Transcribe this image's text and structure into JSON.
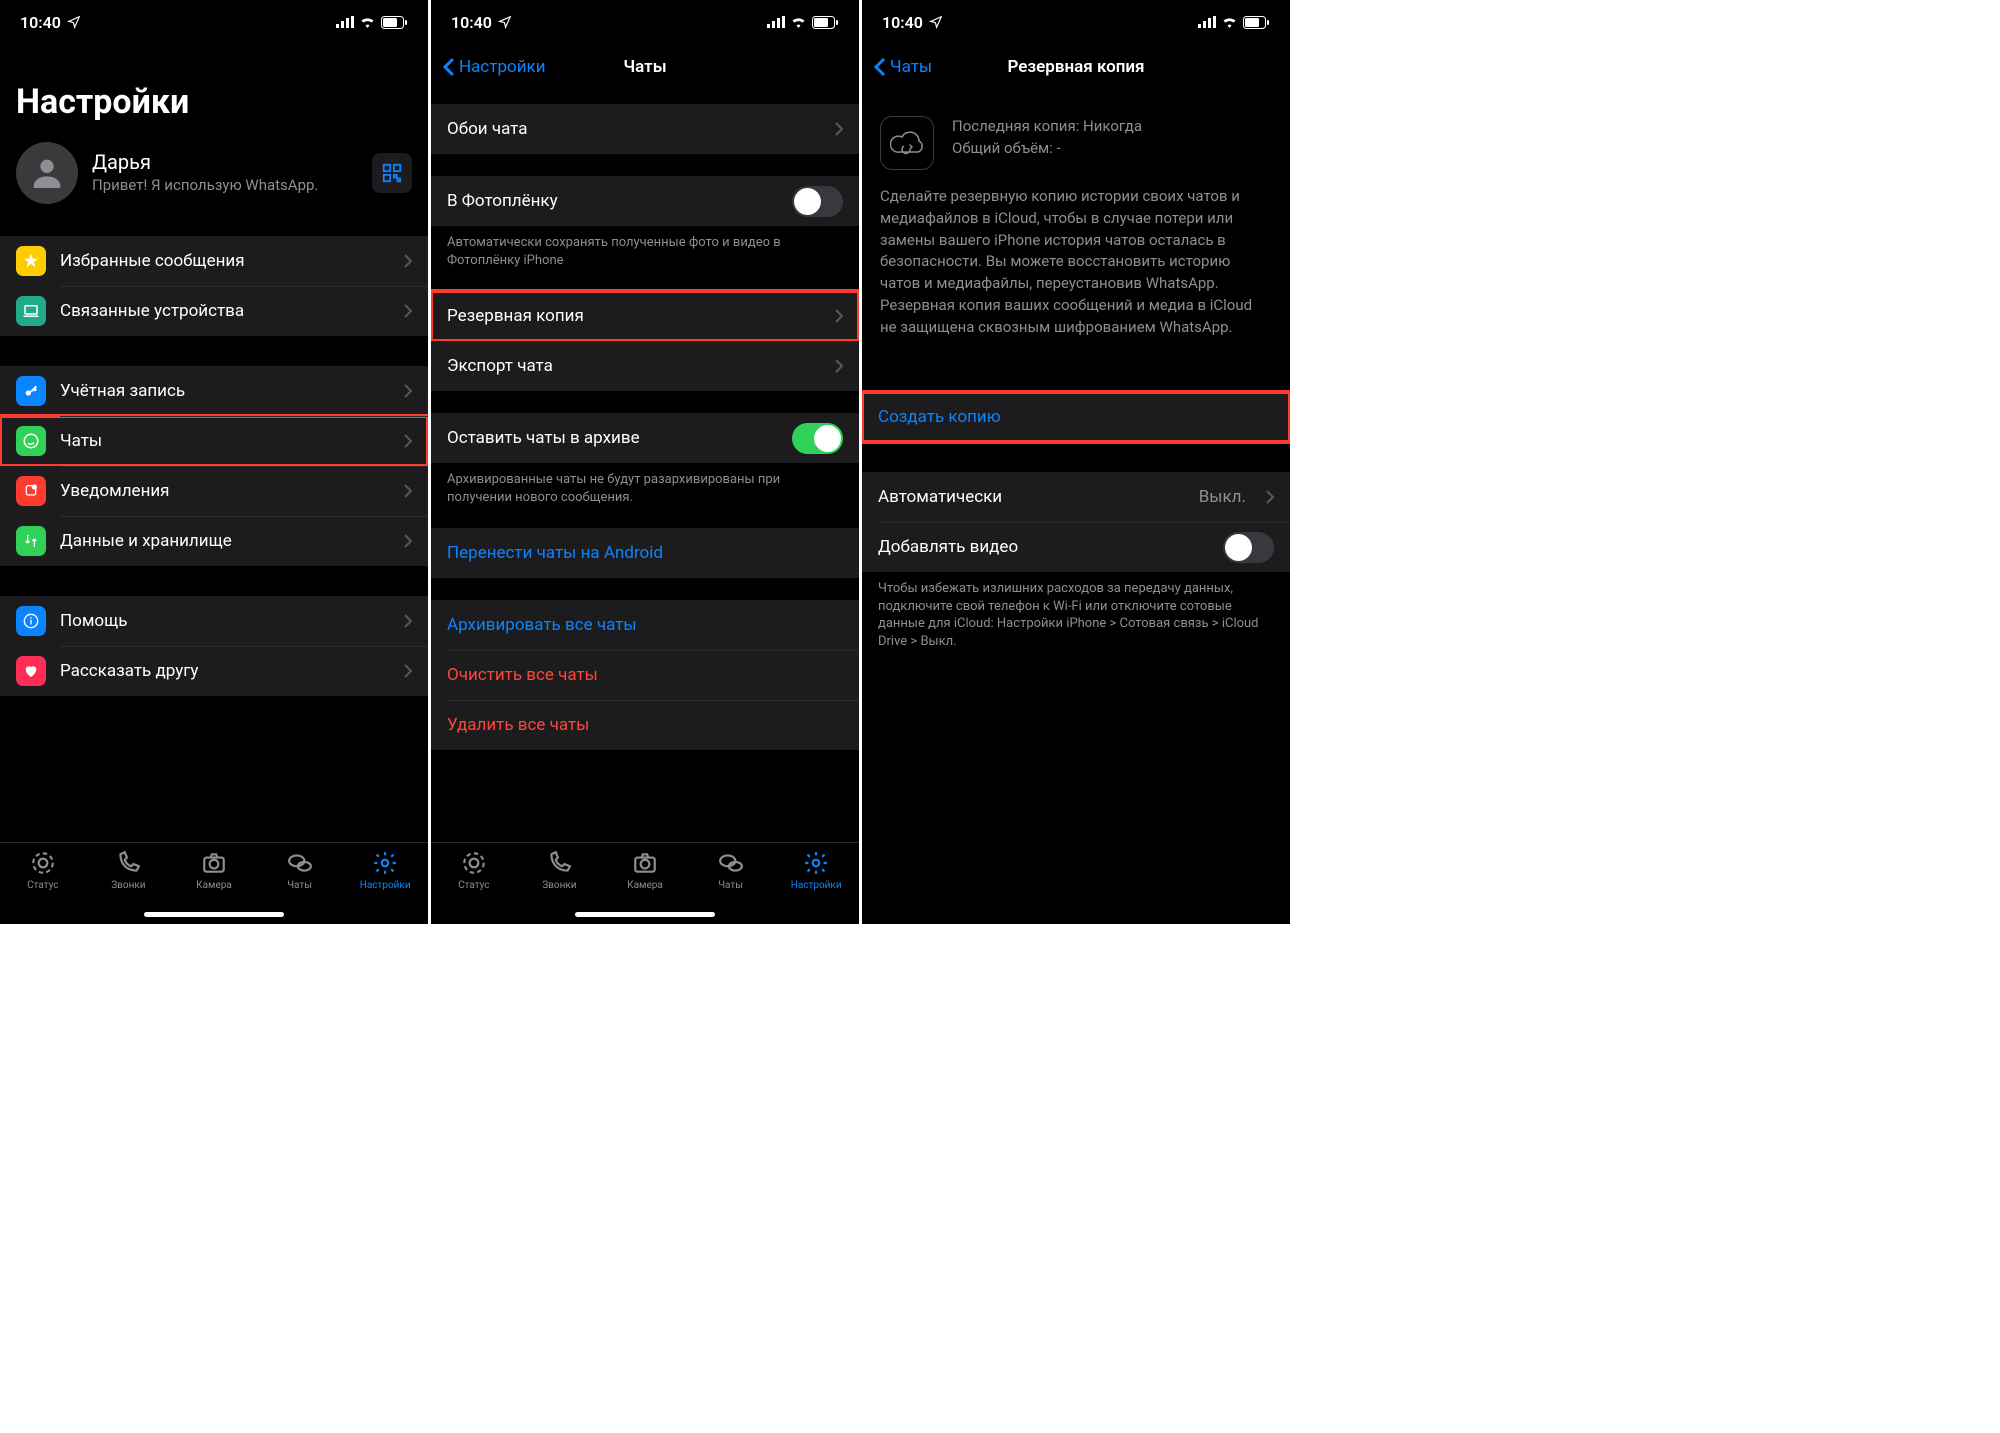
{
  "status": {
    "time": "10:40"
  },
  "tabs": {
    "status": "Статус",
    "calls": "Звонки",
    "camera": "Камера",
    "chats": "Чаты",
    "settings": "Настройки"
  },
  "screen1": {
    "title": "Настройки",
    "profile": {
      "name": "Дарья",
      "status": "Привет! Я использую WhatsApp."
    },
    "rows": {
      "starred": "Избранные сообщения",
      "linked": "Связанные устройства",
      "account": "Учётная запись",
      "chats": "Чаты",
      "notifications": "Уведомления",
      "storage": "Данные и хранилище",
      "help": "Помощь",
      "tell": "Рассказать другу"
    }
  },
  "screen2": {
    "back": "Настройки",
    "title": "Чаты",
    "rows": {
      "wallpaper": "Обои чата",
      "saveMedia": "В Фотоплёнку",
      "saveMediaNote": "Автоматически сохранять полученные фото и видео в Фотоплёнку iPhone",
      "backup": "Резервная копия",
      "export": "Экспорт чата",
      "keepArchived": "Оставить чаты в архиве",
      "keepArchivedNote": "Архивированные чаты не будут разархивированы при получении нового сообщения.",
      "moveAndroid": "Перенести чаты на Android",
      "archiveAll": "Архивировать все чаты",
      "clearAll": "Очистить все чаты",
      "deleteAll": "Удалить все чаты"
    }
  },
  "screen3": {
    "back": "Чаты",
    "title": "Резервная копия",
    "lastBackup": "Последняя копия: Никогда",
    "totalSize": "Общий объём: -",
    "description": "Сделайте резервную копию истории своих чатов и медиафайлов в iCloud, чтобы в случае потери или замены вашего iPhone история чатов осталась в безопасности. Вы можете восстановить историю чатов и медиафайлы, переустановив WhatsApp. Резервная копия ваших сообщений и медиа в iCloud не защищена сквозным шифрованием WhatsApp.",
    "createBackup": "Создать копию",
    "auto": "Автоматически",
    "autoValue": "Выкл.",
    "includeVideo": "Добавлять видео",
    "videoNote": "Чтобы избежать излишних расходов за передачу данных, подключите свой телефон к Wi-Fi или отключите сотовые данные для iCloud: Настройки iPhone > Сотовая связь > iCloud Drive > Выкл."
  }
}
